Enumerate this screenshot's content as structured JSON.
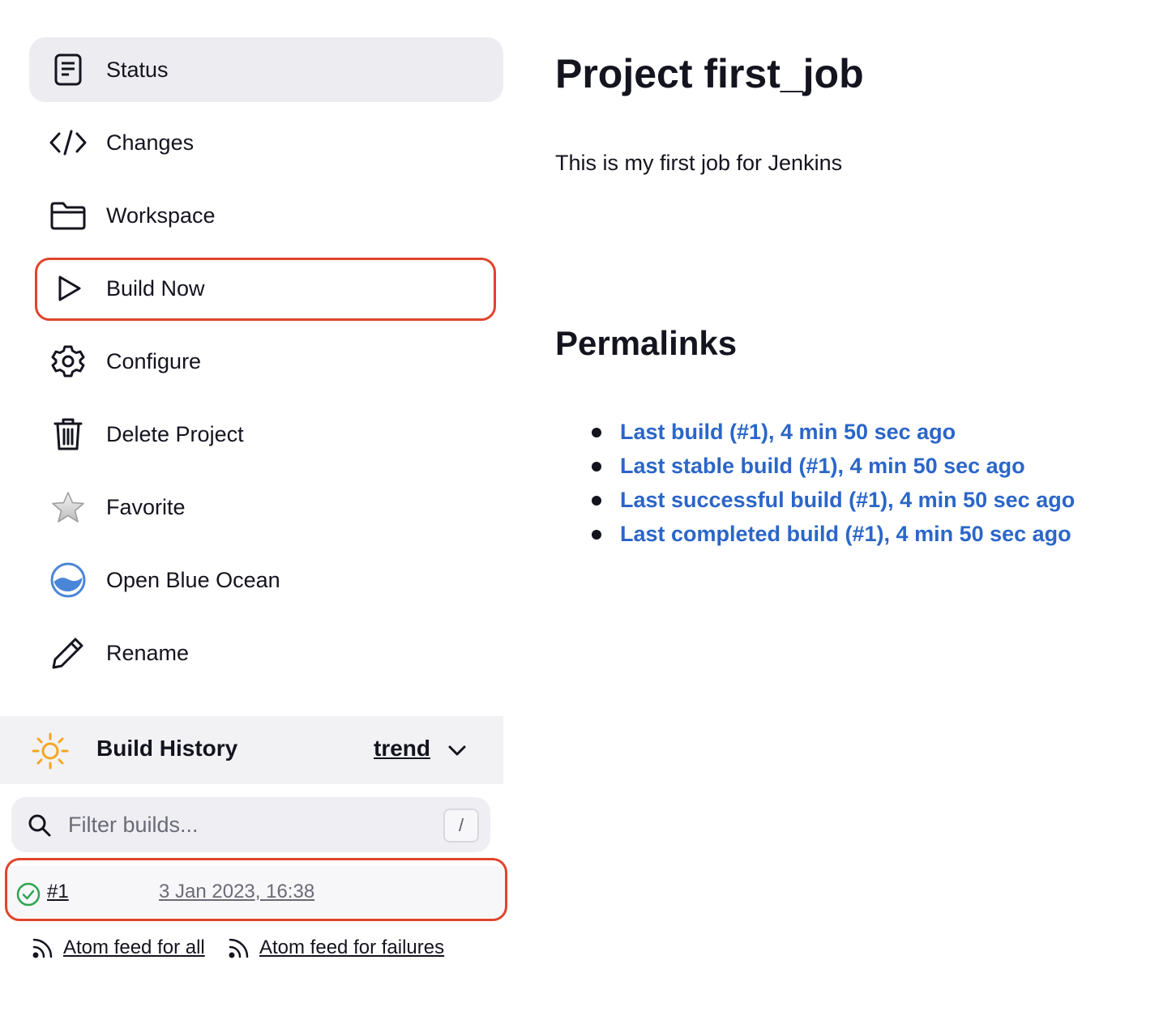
{
  "sidebar": {
    "items": [
      {
        "label": "Status",
        "icon": "document-icon",
        "active": true
      },
      {
        "label": "Changes",
        "icon": "code-icon"
      },
      {
        "label": "Workspace",
        "icon": "folder-icon"
      },
      {
        "label": "Build Now",
        "icon": "play-icon"
      },
      {
        "label": "Configure",
        "icon": "gear-icon"
      },
      {
        "label": "Delete Project",
        "icon": "trash-icon"
      },
      {
        "label": "Favorite",
        "icon": "star-icon"
      },
      {
        "label": "Open Blue Ocean",
        "icon": "blue-ocean-icon"
      },
      {
        "label": "Rename",
        "icon": "pencil-icon"
      }
    ]
  },
  "build_history": {
    "title": "Build History",
    "trend_label": "trend",
    "filter_placeholder": "Filter builds...",
    "filter_shortcut": "/",
    "builds": [
      {
        "number": "#1",
        "date": "3 Jan 2023, 16:38",
        "status": "success"
      }
    ],
    "feeds": {
      "all": "Atom feed for all",
      "failures": "Atom feed for failures"
    }
  },
  "main": {
    "title": "Project first_job",
    "description": "This is my first job for Jenkins",
    "permalinks_heading": "Permalinks",
    "permalinks": [
      "Last build (#1), 4 min 50 sec ago",
      "Last stable build (#1), 4 min 50 sec ago",
      "Last successful build (#1), 4 min 50 sec ago",
      "Last completed build (#1), 4 min 50 sec ago"
    ]
  },
  "colors": {
    "link": "#2b66c8",
    "highlight": "#e0442c",
    "active_bg": "#ededf1",
    "success": "#2fa44f",
    "sun": "#f5a623"
  }
}
